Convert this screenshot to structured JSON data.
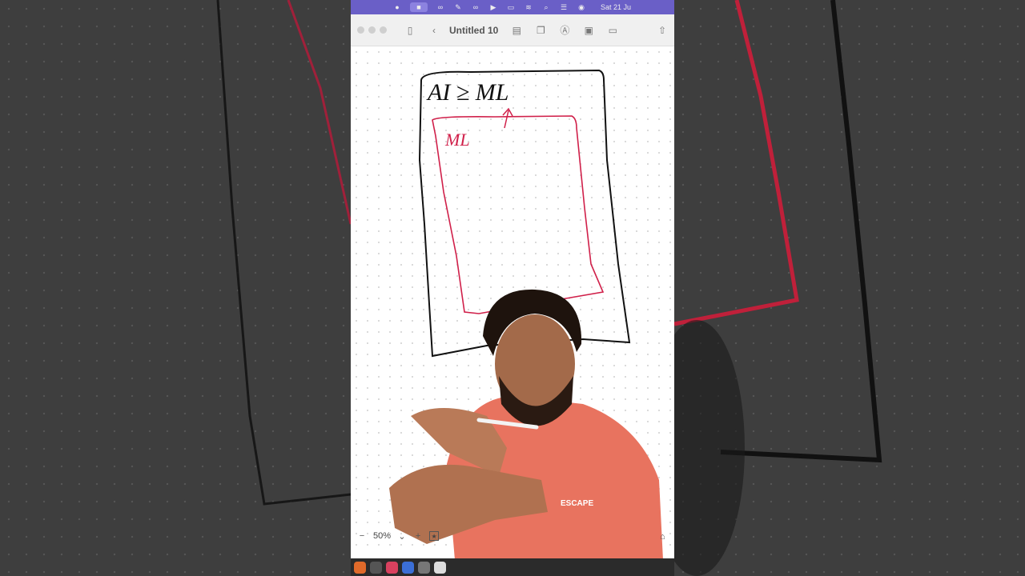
{
  "menubar": {
    "clock": "Sat 21 Ju"
  },
  "toolbar": {
    "title": "Untitled 10"
  },
  "canvas": {
    "handwriting_black": "AI ≥ ML",
    "handwriting_red": "ML"
  },
  "zoom": {
    "level": "50%",
    "minus": "−",
    "plus": "+"
  },
  "shirt": {
    "print": "ESCAPE"
  },
  "colors": {
    "menubar": "#6a5fc7",
    "red_ink": "#d0204a",
    "black_ink": "#111111",
    "shirt": "#e8735f"
  }
}
